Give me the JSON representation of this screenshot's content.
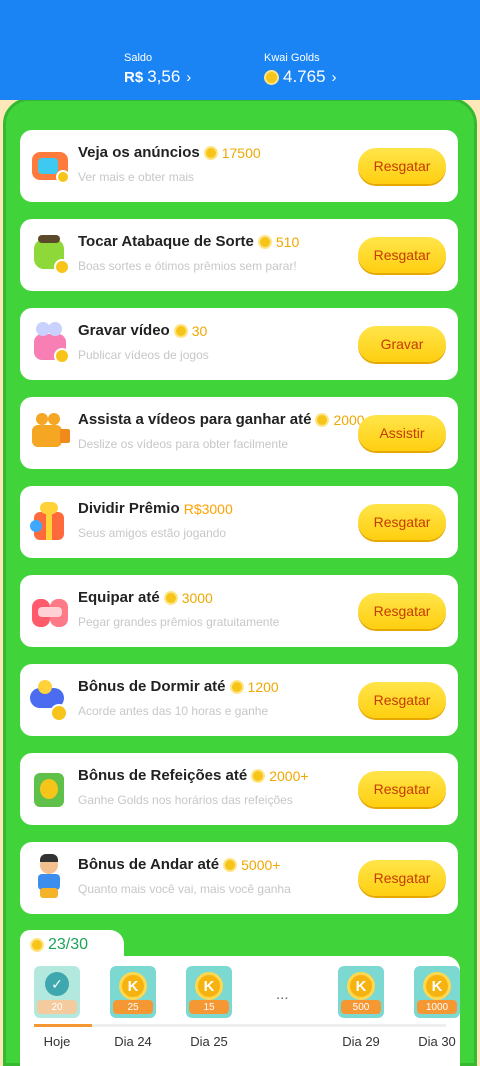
{
  "header": {
    "balance": {
      "label": "Saldo",
      "currency": "R$",
      "value": "3,56",
      "chevron": "›"
    },
    "golds": {
      "label": "Kwai Golds",
      "value": "4.765",
      "chevron": "›"
    }
  },
  "tasks": [
    {
      "title": "Veja os anúncios",
      "amount": "17500",
      "subtitle": "Ver mais e obter mais",
      "button": "Resgatar",
      "icon": "tv-icon"
    },
    {
      "title": "Tocar Atabaque de Sorte",
      "amount": "510",
      "subtitle": "Boas sortes e ótimos prêmios sem parar!",
      "button": "Resgatar",
      "icon": "drum-icon"
    },
    {
      "title": "Gravar vídeo",
      "amount": "30",
      "subtitle": "Publicar vídeos de jogos",
      "button": "Gravar",
      "icon": "camera-icon"
    },
    {
      "title": "Assista a vídeos para ganhar até",
      "amount": "2000",
      "subtitle": "Deslize os vídeos para obter facilmente",
      "button": "Assistir",
      "icon": "video-camera-icon"
    },
    {
      "title": "Dividir Prêmio",
      "amount": "R$3000",
      "subtitle": "Seus amigos estão jogando",
      "button": "Resgatar",
      "icon": "gift-icon"
    },
    {
      "title": "Equipar até",
      "amount": "3000",
      "subtitle": "Pegar grandes prêmios gratuitamente",
      "button": "Resgatar",
      "icon": "gift-box-icon"
    },
    {
      "title": "Bônus de Dormir até",
      "amount": "1200",
      "subtitle": "Acorde antes das 10 horas e ganhe",
      "button": "Resgatar",
      "icon": "sleep-icon"
    },
    {
      "title": "Bônus de Refeições até",
      "amount": "2000+",
      "subtitle": "Ganhe Golds nos horários das refeições",
      "button": "Resgatar",
      "icon": "meal-icon"
    },
    {
      "title": "Bônus de Andar até",
      "amount": "5000+",
      "subtitle": "Quanto mais você vai, mais você ganha",
      "button": "Resgatar",
      "icon": "walk-icon"
    }
  ],
  "streak": {
    "count": "23/30",
    "ellipsis": "...",
    "progress_fraction": 0.14,
    "days": [
      {
        "label": "Hoje",
        "reward": "20",
        "done": true
      },
      {
        "label": "Dia 24",
        "reward": "25",
        "coin": "K"
      },
      {
        "label": "Dia 25",
        "reward": "15",
        "coin": "K"
      },
      {
        "label": "Dia 29",
        "reward": "500",
        "coin": "K"
      },
      {
        "label": "Dia 30",
        "reward": "1000",
        "coin": "K"
      }
    ]
  }
}
